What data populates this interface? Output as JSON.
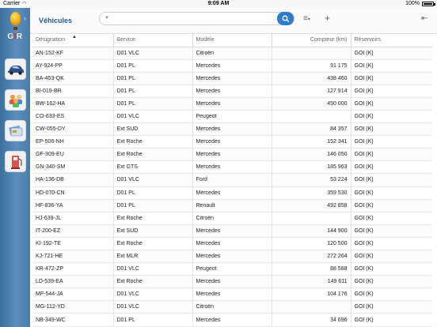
{
  "status": {
    "carrier": "Carrier",
    "time": "9:09 AM",
    "battery": "100%"
  },
  "sidebar": {
    "logo_text_a": "G",
    "logo_text_b": "I",
    "logo_text_c": "R",
    "items": [
      {
        "icon": "car-icon"
      },
      {
        "icon": "users-icon"
      },
      {
        "icon": "card-icon"
      },
      {
        "icon": "fuel-pump-icon"
      }
    ]
  },
  "header": {
    "title": "Véhicules",
    "search_placeholder": ""
  },
  "table": {
    "columns": [
      "Désignation",
      "Service",
      "Modèle",
      "Compteur (km)",
      "Réservoirs"
    ],
    "rows": [
      [
        "AN-152-KF",
        "D01 VLC",
        "Citroën",
        "",
        "GOI (K)"
      ],
      [
        "AY-924-PP",
        "D01 PL",
        "Mercedes",
        "91 175",
        "GOI (K)"
      ],
      [
        "BA-453-QK",
        "D01 PL",
        "Mercedes",
        "438 460",
        "GOI (K)"
      ],
      [
        "BI-019-BR",
        "D01 PL",
        "Mercedes",
        "127 914",
        "GOI (K)"
      ],
      [
        "BW-162-HA",
        "D01 PL",
        "Mercedes",
        "450 000",
        "GOI (K)"
      ],
      [
        "CO-633-ES",
        "D01 VLC",
        "Peugeot",
        "",
        "GOI (K)"
      ],
      [
        "CW-055-DY",
        "Ext SUD",
        "Mercedes",
        "84 357",
        "GOI (K)"
      ],
      [
        "EP-506-NH",
        "Ext Roche",
        "Mercedes",
        "152 341",
        "GOI (K)"
      ],
      [
        "GF-309-EU",
        "Ext Roche",
        "Mercedes",
        "146 050",
        "GOI (K)"
      ],
      [
        "GN-340-SM",
        "Ext GTS",
        "Mercedes",
        "185 963",
        "GOI (K)"
      ],
      [
        "HA-136-DB",
        "D01 VLC",
        "Ford",
        "53 224",
        "GOI (K)"
      ],
      [
        "HD-070-CN",
        "D01 PL",
        "Mercedes",
        "359 530",
        "GOI (K)"
      ],
      [
        "HF-836-YA",
        "D01 PL",
        "Renault",
        "492 858",
        "GOI (K)"
      ],
      [
        "HJ-639-JL",
        "Ext Roche",
        "Citroën",
        "",
        "GOI (K)"
      ],
      [
        "IT-200-EZ",
        "Ext SUD",
        "Mercedes",
        "144 900",
        "GOI (K)"
      ],
      [
        "KI-192-TE",
        "Ext Roche",
        "Mercedes",
        "120 500",
        "GOI (K)"
      ],
      [
        "KJ-721-HE",
        "Ext MLR",
        "Mercedes",
        "272 264",
        "GOI (K)"
      ],
      [
        "KR-472-ZP",
        "D01 VLC",
        "Peugeot",
        "88 588",
        "GOI (K)"
      ],
      [
        "LD-539-EA",
        "Ext Roche",
        "Mercedes",
        "149 611",
        "GOI (K)"
      ],
      [
        "MF-544-JA",
        "D01 VLC",
        "Mercedes",
        "104 176",
        "GOI (K)"
      ],
      [
        "MG-112-YD",
        "D01 VLC",
        "Citroën",
        "",
        "GOI (K)"
      ],
      [
        "NB-349-WC",
        "D01 PL",
        "Mercedes",
        "34 696",
        "GOI (K)"
      ]
    ]
  },
  "colors": {
    "accent": "#2e7cd1",
    "title": "#2a5b8e",
    "sidebar": "#4a7aa8"
  }
}
